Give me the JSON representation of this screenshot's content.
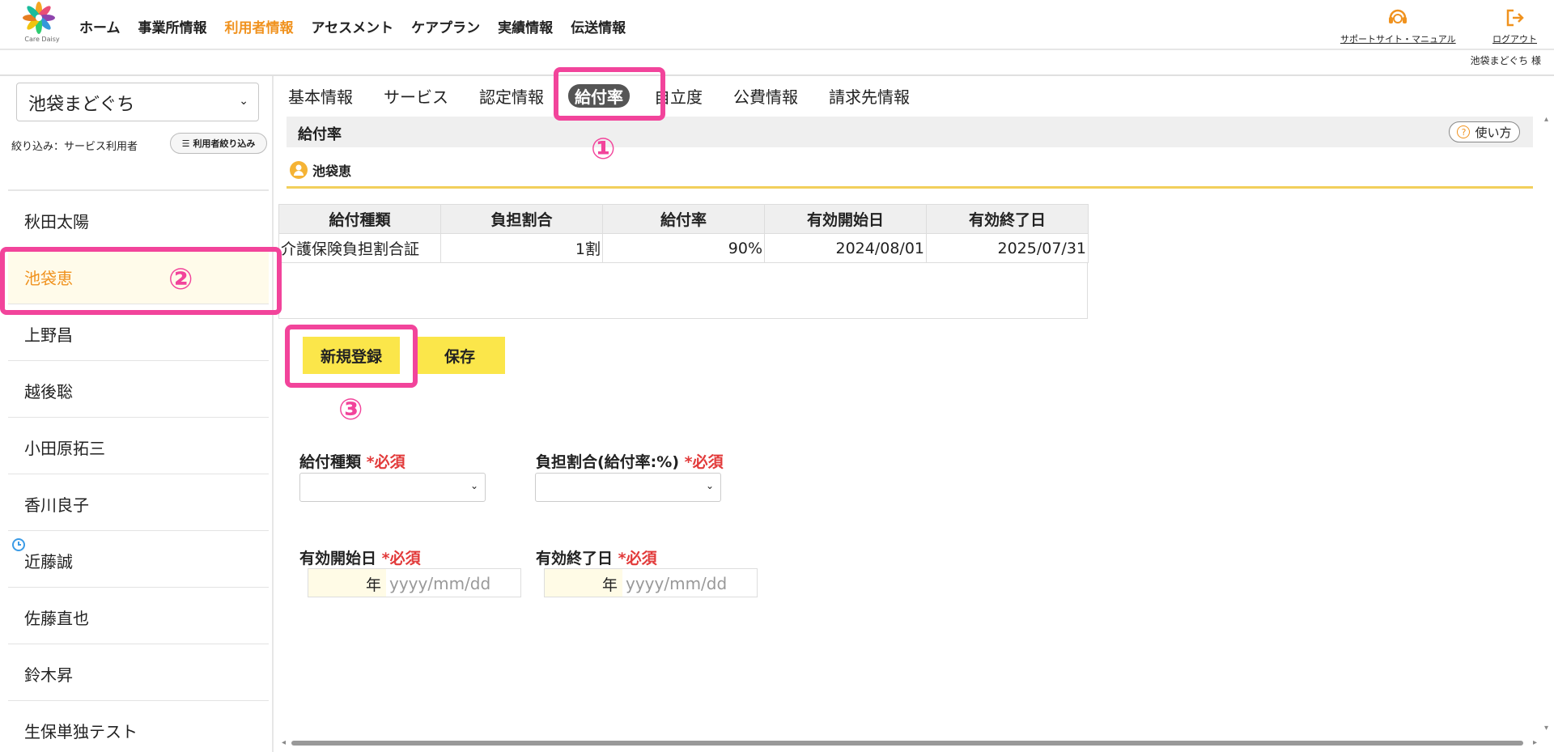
{
  "header": {
    "logo_text": "Care Daisy",
    "nav": [
      "ホーム",
      "事業所情報",
      "利用者情報",
      "アセスメント",
      "ケアプラン",
      "実績情報",
      "伝送情報"
    ],
    "nav_active_index": 2,
    "support_label": "サポートサイト・マニュアル",
    "logout_label": "ログアウト",
    "user_label": "池袋まどぐち 様"
  },
  "sidebar": {
    "office_select": "池袋まどぐち",
    "filter_label": "絞り込み：サービス利用者",
    "filter_button": "利用者絞り込み",
    "users": [
      "秋田太陽",
      "池袋恵",
      "上野昌",
      "越後聡",
      "小田原拓三",
      "香川良子",
      "近藤誠",
      "佐藤直也",
      "鈴木昇",
      "生保単独テスト"
    ],
    "selected_index": 1
  },
  "tabs": [
    "基本情報",
    "サービス",
    "認定情報",
    "給付率",
    "自立度",
    "公費情報",
    "請求先情報"
  ],
  "active_tab_index": 3,
  "section": {
    "title": "給付率",
    "howto_label": "使い方",
    "person_name": "池袋恵"
  },
  "table": {
    "headers": [
      "給付種類",
      "負担割合",
      "給付率",
      "有効開始日",
      "有効終了日"
    ],
    "rows": [
      [
        "介護保険負担割合証",
        "1割",
        "90%",
        "2024/08/01",
        "2025/07/31"
      ]
    ]
  },
  "buttons": {
    "new_label": "新規登録",
    "save_label": "保存"
  },
  "form": {
    "kind_label": "給付種類",
    "ratio_label": "負担割合(給付率:%)",
    "start_label": "有効開始日",
    "end_label": "有効終了日",
    "required_mark": "*必須",
    "era_suffix": "年",
    "date_placeholder": "yyyy/mm/dd"
  },
  "annotations": [
    "①",
    "②",
    "③"
  ],
  "colors": {
    "accent": "#f0921e",
    "annotation": "#f2449b",
    "button": "#fbe64a",
    "required": "#e23a3a"
  }
}
